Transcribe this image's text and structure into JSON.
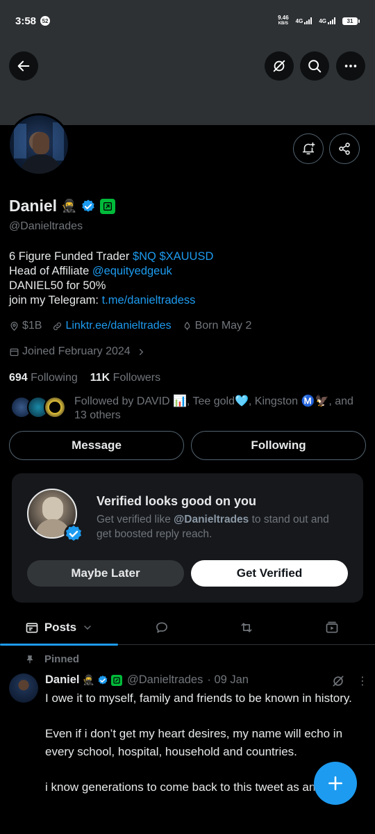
{
  "status_bar": {
    "time": "3:58",
    "notif_count": "52",
    "speed": "9.46",
    "speed_unit": "KB/S",
    "net1": "4G",
    "net2": "4G",
    "battery": "31"
  },
  "profile": {
    "name": "Daniel",
    "name_emoji": "🥷",
    "handle": "@Danieltrades",
    "bio": {
      "line1_text": "6 Figure Funded Trader ",
      "line1_link": "$NQ $XAUUSD",
      "line2_text": "Head of Affiliate ",
      "line2_link": "@equityedgeuk",
      "line3": "DANIEL50 for 50%",
      "line4_text": "join my Telegram: ",
      "line4_link": "t.me/danieltradess"
    },
    "location": "$1B",
    "website": "Linktr.ee/danieltrades",
    "birthday": "Born May 2",
    "joined": "Joined February 2024",
    "following_count": "694",
    "following_label": "Following",
    "followers_count": "11K",
    "followers_label": "Followers",
    "followed_by": "Followed by DAVID 📊, Tee gold🩵, Kingston Ⓜ️🦅, and 13 others"
  },
  "actions": {
    "message": "Message",
    "following": "Following"
  },
  "verified_card": {
    "title": "Verified looks good on you",
    "subtitle_pre": "Get verified like ",
    "subtitle_handle": "@Danieltrades",
    "subtitle_post": " to stand out and get boosted reply reach.",
    "maybe_later": "Maybe Later",
    "get_verified": "Get Verified"
  },
  "tabs": {
    "posts": "Posts"
  },
  "pinned_tweet": {
    "pinned_label": "Pinned",
    "name": "Daniel",
    "name_emoji": "🥷",
    "handle": "@Danieltrades",
    "date": "· 09 Jan",
    "more": "⋮",
    "body": "I owe it to myself, family and friends to be known in history.\n\nEven if i don’t get my heart desires, my name will echo in every school, hospital, household and countries.\n\ni know generations to come back to this tweet as an"
  },
  "colors": {
    "accent": "#1d9bf0",
    "background": "#000000",
    "banner": "#2d3134",
    "muted": "#71767b",
    "affiliate": "#00ba3a"
  },
  "icons": [
    "back-arrow-icon",
    "grok-icon",
    "search-icon",
    "more-icon",
    "notification-add-icon",
    "share-icon",
    "verified-badge-icon",
    "affiliate-badge-icon",
    "location-icon",
    "link-icon",
    "birthday-icon",
    "calendar-icon",
    "chevron-right-icon",
    "chevron-down-icon",
    "replies-icon",
    "reposts-icon",
    "media-icon",
    "pin-icon",
    "compose-plus-icon"
  ]
}
